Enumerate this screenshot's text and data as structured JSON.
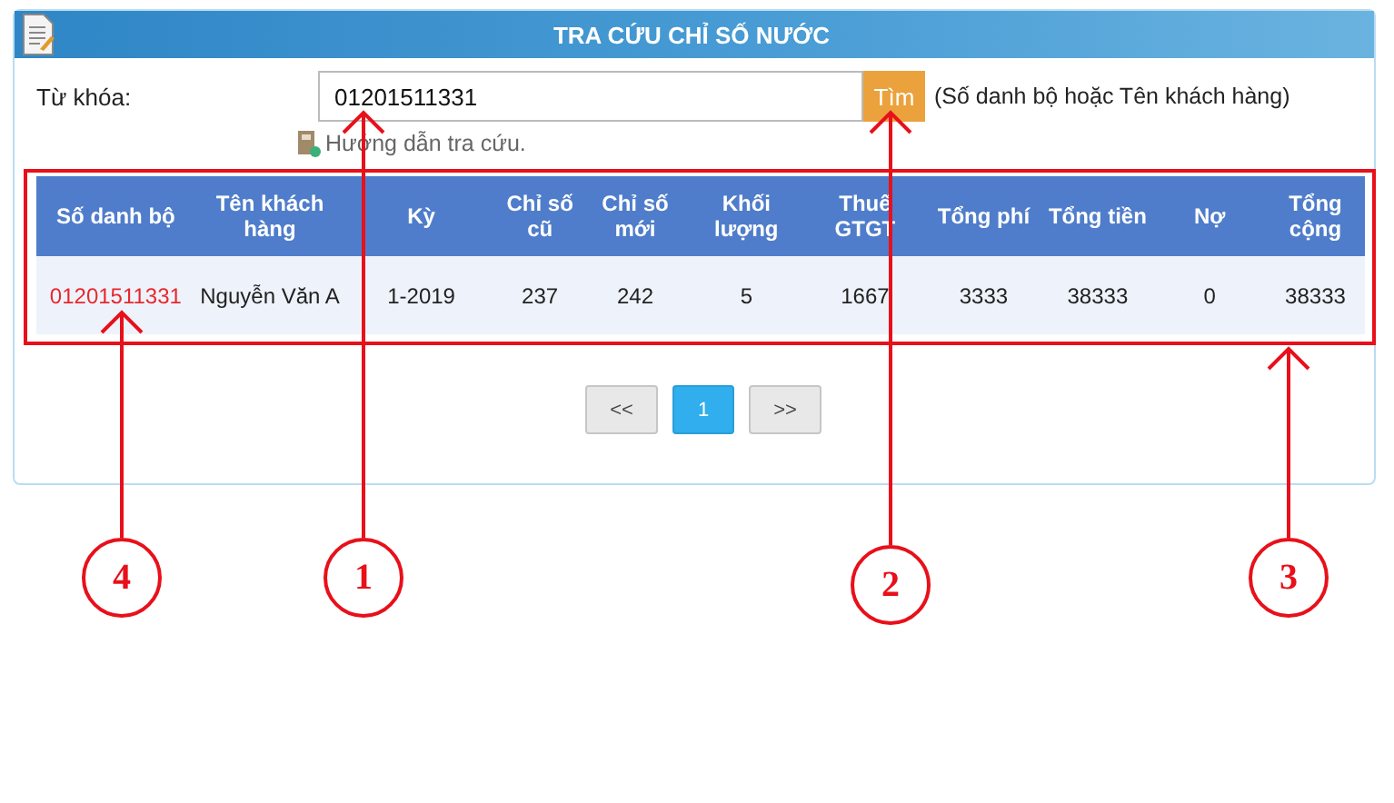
{
  "window": {
    "title": "TRA CỨU CHỈ SỐ NƯỚC"
  },
  "search": {
    "label": "Từ khóa:",
    "value": "01201511331",
    "button": "Tìm",
    "hint": "(Số danh bộ hoặc Tên khách hàng)"
  },
  "guide_link": "Hướng dẫn tra cứu.",
  "table": {
    "columns": [
      "Số danh bộ",
      "Tên khách hàng",
      "Kỳ",
      "Chỉ số cũ",
      "Chỉ số mới",
      "Khối lượng",
      "Thuế GTGT",
      "Tổng phí",
      "Tổng tiền",
      "Nợ",
      "Tổng cộng"
    ],
    "rows": [
      [
        "01201511331",
        "Nguyễn Văn A",
        "1-2019",
        "237",
        "242",
        "5",
        "1667",
        "3333",
        "38333",
        "0",
        "38333"
      ]
    ]
  },
  "pagination": [
    {
      "label": "<<",
      "selected": false
    },
    {
      "label": "1",
      "selected": true
    },
    {
      "label": ">>",
      "selected": false
    }
  ],
  "annotations": [
    {
      "label": "4"
    },
    {
      "label": "1"
    },
    {
      "label": "2"
    },
    {
      "label": "3"
    }
  ]
}
